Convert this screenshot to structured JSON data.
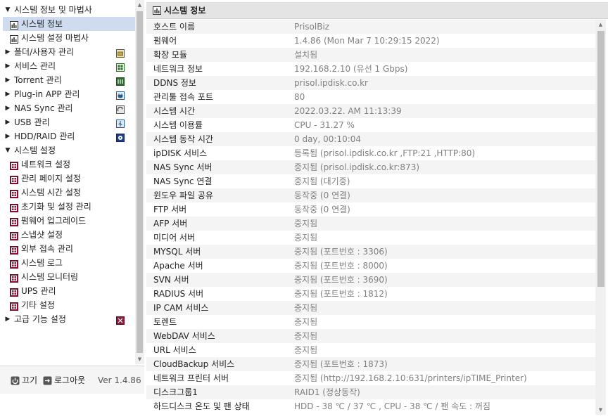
{
  "sidebar": {
    "items": [
      {
        "label": "시스템 정보 및 마법사",
        "level": 0,
        "expanded": true,
        "icon": "caret-down-icon"
      },
      {
        "label": "시스템 정보",
        "level": 1,
        "selected": true,
        "icon": "bar-chart-icon"
      },
      {
        "label": "시스템 설정 마법사",
        "level": 1,
        "icon": "bar-chart-icon"
      },
      {
        "label": "폴더/사용자 관리",
        "level": 0,
        "expanded": false,
        "icon": "caret-right-icon",
        "right_icon": "folder-user-icon"
      },
      {
        "label": "서비스 관리",
        "level": 0,
        "expanded": false,
        "icon": "caret-right-icon",
        "right_icon": "service-icon"
      },
      {
        "label": "Torrent 관리",
        "level": 0,
        "expanded": false,
        "icon": "caret-right-icon",
        "right_icon": "torrent-icon"
      },
      {
        "label": "Plug-in APP 관리",
        "level": 0,
        "expanded": false,
        "icon": "caret-right-icon",
        "right_icon": "plugin-icon"
      },
      {
        "label": "NAS Sync 관리",
        "level": 0,
        "expanded": false,
        "icon": "caret-right-icon",
        "right_icon": "nas-sync-icon"
      },
      {
        "label": "USB 관리",
        "level": 0,
        "expanded": false,
        "icon": "caret-right-icon",
        "right_icon": "usb-icon"
      },
      {
        "label": "HDD/RAID 관리",
        "level": 0,
        "expanded": false,
        "icon": "caret-right-icon",
        "right_icon": "hdd-icon"
      },
      {
        "label": "시스템 설정",
        "level": 0,
        "expanded": true,
        "icon": "caret-down-icon"
      },
      {
        "label": "네트워크 설정",
        "level": 1,
        "icon": "settings-grid-icon"
      },
      {
        "label": "관리 페이지 설정",
        "level": 1,
        "icon": "settings-grid-icon"
      },
      {
        "label": "시스템 시간 설정",
        "level": 1,
        "icon": "settings-grid-icon"
      },
      {
        "label": "초기화 및 설정 관리",
        "level": 1,
        "icon": "settings-grid-icon"
      },
      {
        "label": "펌웨어 업그레이드",
        "level": 1,
        "icon": "settings-grid-icon"
      },
      {
        "label": "스냅샷 설정",
        "level": 1,
        "icon": "settings-grid-icon"
      },
      {
        "label": "외부 접속 관리",
        "level": 1,
        "icon": "settings-grid-icon"
      },
      {
        "label": "시스템 로그",
        "level": 1,
        "icon": "settings-grid-icon"
      },
      {
        "label": "시스템 모니터링",
        "level": 1,
        "icon": "settings-grid-icon"
      },
      {
        "label": "UPS 관리",
        "level": 1,
        "icon": "settings-grid-icon"
      },
      {
        "label": "기타 설정",
        "level": 1,
        "icon": "settings-grid-icon"
      },
      {
        "label": "고급 기능 설정",
        "level": 0,
        "expanded": false,
        "icon": "caret-right-icon",
        "right_icon": "advanced-icon"
      }
    ]
  },
  "footer": {
    "off_label": "끄기",
    "logout_label": "로그아웃",
    "version": "Ver 1.4.86"
  },
  "main": {
    "title": "시스템 정보",
    "rows": [
      {
        "key": "호스트 이름",
        "value": "PrisolBiz"
      },
      {
        "key": "펌웨어",
        "value": "1.4.86 (Mon Mar 7 10:29:15 2022)"
      },
      {
        "key": "확장 모듈",
        "value": "설치됨"
      },
      {
        "key": "네트워크 정보",
        "value": "192.168.2.10 (유선 1 Gbps)"
      },
      {
        "key": "DDNS 정보",
        "value": "prisol.ipdisk.co.kr"
      },
      {
        "key": "관리툴 접속 포트",
        "value": "80"
      },
      {
        "key": "시스템 시간",
        "value": "2022.03.22. AM 11:13:39"
      },
      {
        "key": "시스템 이용률",
        "value": "CPU - 31.27 %"
      },
      {
        "key": "시스템 동작 시간",
        "value": "0 day, 00:10:04"
      },
      {
        "key": "ipDISK 서비스",
        "value": "등록됨 (prisol.ipdisk.co.kr ,FTP:21 ,HTTP:80)"
      },
      {
        "key": "NAS Sync 서버",
        "value": "중지됨 (prisol.ipdisk.co.kr:873)"
      },
      {
        "key": "NAS Sync 연결",
        "value": "중지됨 (대기중)"
      },
      {
        "key": "윈도우 파일 공유",
        "value": "동작중 (0 연결)"
      },
      {
        "key": "FTP 서버",
        "value": "동작중 (0 연결)"
      },
      {
        "key": "AFP 서버",
        "value": "중지됨"
      },
      {
        "key": "미디어 서버",
        "value": "중지됨"
      },
      {
        "key": "MYSQL 서버",
        "value": "중지됨 (포트번호 : 3306)"
      },
      {
        "key": "Apache 서버",
        "value": "중지됨 (포트번호 : 8000)"
      },
      {
        "key": "SVN 서버",
        "value": "중지됨 (포트번호 : 3690)"
      },
      {
        "key": "RADIUS 서버",
        "value": "중지됨 (포트번호 : 1812)"
      },
      {
        "key": "IP CAM 서비스",
        "value": "중지됨"
      },
      {
        "key": "토렌트",
        "value": "중지됨"
      },
      {
        "key": "WebDAV 서비스",
        "value": "중지됨"
      },
      {
        "key": "URL 서비스",
        "value": "중지됨"
      },
      {
        "key": "CloudBackup 서비스",
        "value": "중지됨 (포트번호 : 1873)"
      },
      {
        "key": "네트워크 프린터 서버",
        "value": "중지됨 (http://192.168.2.10:631/printers/ipTIME_Printer)"
      },
      {
        "key": "디스크그룹1",
        "value": "RAID1 (정상동작)"
      },
      {
        "key": "하드디스크 온도 및 팬 상태",
        "value": "HDD - 38 ℃ / 37 ℃ , CPU - 38 ℃ / 팬 속도 : 꺼짐"
      }
    ]
  }
}
